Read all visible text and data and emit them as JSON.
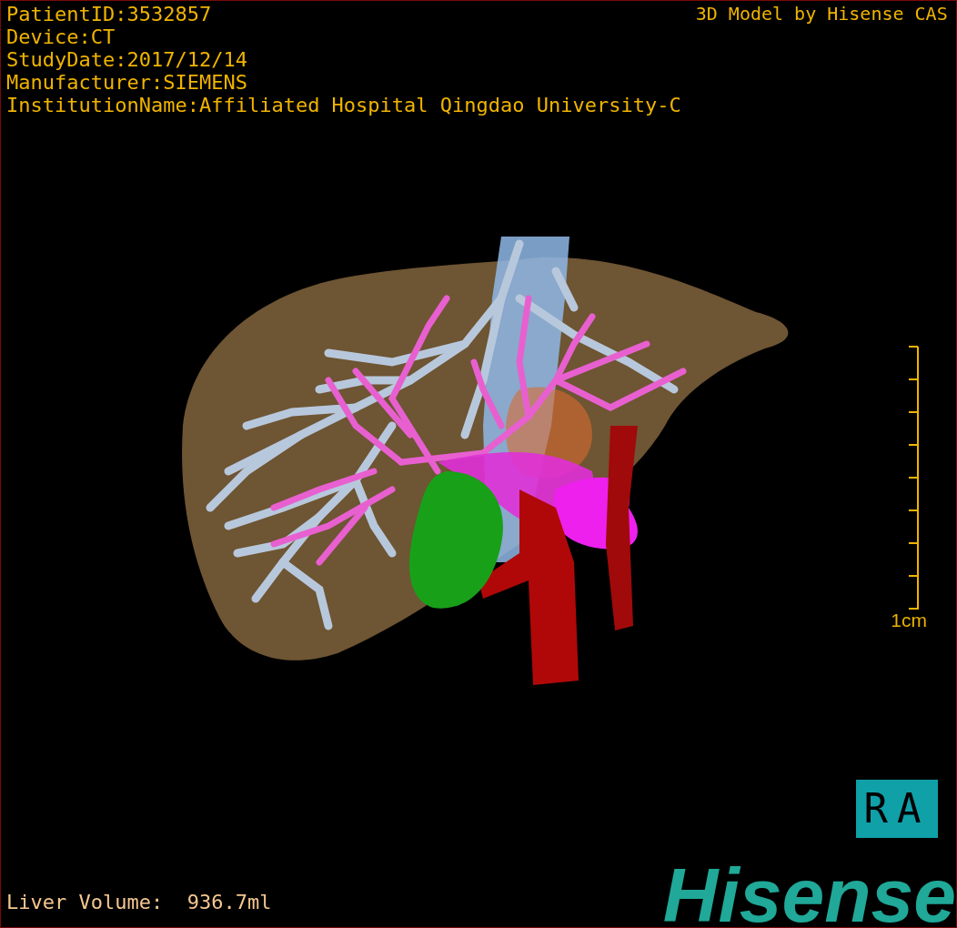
{
  "info_lines": [
    "PatientID:3532857",
    "Device:CT",
    "StudyDate:2017/12/14",
    "Manufacturer:SIEMENS",
    "InstitutionName:Affiliated Hospital Qingdao University-C"
  ],
  "credit": "3D Model by Hisense CAS",
  "scale_bar": {
    "label": "1cm"
  },
  "orientation": "RA",
  "liver_volume": "Liver Volume:  936.7ml",
  "logo": "Hisense"
}
